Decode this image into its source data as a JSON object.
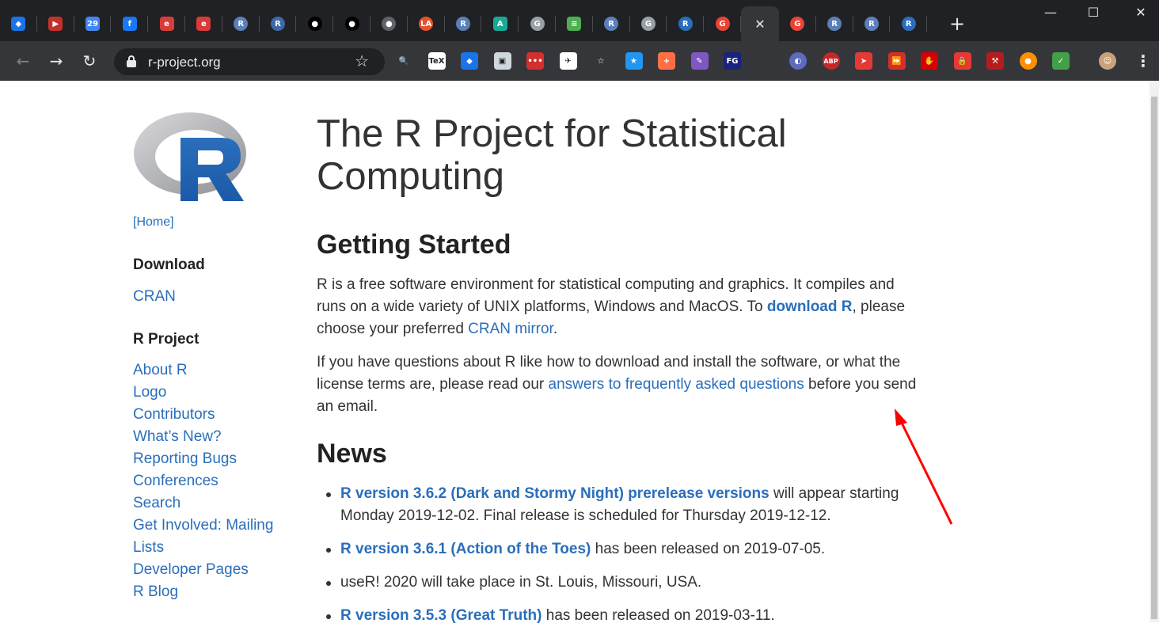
{
  "tabs": [
    {
      "icon": "gem-icon",
      "color": "#1a73e8",
      "glyph": "◆"
    },
    {
      "icon": "youtube-icon",
      "color": "#c4302b",
      "glyph": "▶"
    },
    {
      "icon": "calendar-icon",
      "color": "#4285f4",
      "glyph": "29"
    },
    {
      "icon": "facebook-icon",
      "color": "#1877f2",
      "glyph": "f"
    },
    {
      "icon": "red-circle-icon",
      "color": "#d93a3a",
      "glyph": "e"
    },
    {
      "icon": "red-circle-icon",
      "color": "#d93a3a",
      "glyph": "e"
    },
    {
      "icon": "r-logo-icon",
      "color": "#5b7fb8",
      "glyph": "R"
    },
    {
      "icon": "r-logo-icon",
      "color": "#3c6aa8",
      "glyph": "R"
    },
    {
      "icon": "github-icon",
      "color": "#000000",
      "glyph": "●"
    },
    {
      "icon": "github-icon",
      "color": "#000000",
      "glyph": "●"
    },
    {
      "icon": "globe-icon",
      "color": "#5f6368",
      "glyph": "●"
    },
    {
      "icon": "la-icon",
      "color": "#e5532d",
      "glyph": "LA"
    },
    {
      "icon": "r-logo-icon",
      "color": "#5b7fb8",
      "glyph": "R"
    },
    {
      "icon": "a-logo-icon",
      "color": "#18a999",
      "glyph": "A"
    },
    {
      "icon": "google-icon",
      "color": "#9aa0a6",
      "glyph": "G"
    },
    {
      "icon": "document-icon",
      "color": "#4caf50",
      "glyph": "≡"
    },
    {
      "icon": "r-logo-icon",
      "color": "#5b7fb8",
      "glyph": "R"
    },
    {
      "icon": "google-icon",
      "color": "#9aa0a6",
      "glyph": "G"
    },
    {
      "icon": "r-logo-icon",
      "color": "#2a6ebb",
      "glyph": "R"
    },
    {
      "icon": "google-icon",
      "color": "#ea4335",
      "glyph": "G"
    }
  ],
  "tabs_after": [
    {
      "icon": "google-icon",
      "color": "#ea4335",
      "glyph": "G"
    },
    {
      "icon": "r-logo-icon",
      "color": "#5b7fb8",
      "glyph": "R"
    },
    {
      "icon": "r-logo-icon",
      "color": "#5b7fb8",
      "glyph": "R"
    },
    {
      "icon": "r-logo-icon",
      "color": "#2a6ebb",
      "glyph": "R"
    }
  ],
  "toolbar": {
    "url": "r-project.org"
  },
  "extensions": [
    {
      "icon": "magnifier-icon",
      "color": "#35363a",
      "glyph": "🔍"
    },
    {
      "icon": "tex-icon",
      "color": "#ffffff",
      "glyph": "TeX"
    },
    {
      "icon": "gem-icon",
      "color": "#1a73e8",
      "glyph": "◆"
    },
    {
      "icon": "image-icon",
      "color": "#cfd8dc",
      "glyph": "▣"
    },
    {
      "icon": "dots-icon",
      "color": "#d32f2f",
      "glyph": "•••"
    },
    {
      "icon": "rocket-icon",
      "color": "#ffffff",
      "glyph": "✈"
    },
    {
      "icon": "star-outline-icon",
      "color": "#35363a",
      "glyph": "☆"
    },
    {
      "icon": "star-badge-icon",
      "color": "#2196f3",
      "glyph": "★"
    },
    {
      "icon": "plus-icon",
      "color": "#ff6f43",
      "glyph": "+"
    },
    {
      "icon": "feather-icon",
      "color": "#7e57c2",
      "glyph": "✎"
    },
    {
      "icon": "fg-icon",
      "color": "#1a237e",
      "glyph": "FG"
    },
    {
      "icon": "blank-icon",
      "color": "#35363a",
      "glyph": ""
    },
    {
      "icon": "moon-icon",
      "color": "#5c6bc0",
      "glyph": "◐"
    },
    {
      "icon": "abp-icon",
      "color": "#c62828",
      "glyph": "ABP"
    },
    {
      "icon": "rocket-red-icon",
      "color": "#e53935",
      "glyph": "➤"
    },
    {
      "icon": "fast-forward-icon",
      "color": "#d32f2f",
      "glyph": "⏩"
    },
    {
      "icon": "hand-stop-icon",
      "color": "#d50000",
      "glyph": "✋"
    },
    {
      "icon": "shield-lock-icon",
      "color": "#e53935",
      "glyph": "🔒"
    },
    {
      "icon": "tools-icon",
      "color": "#b71c1c",
      "glyph": "⚒"
    },
    {
      "icon": "circle-orange-icon",
      "color": "#ff8f00",
      "glyph": "●"
    },
    {
      "icon": "shield-check-icon",
      "color": "#43a047",
      "glyph": "✓"
    }
  ],
  "sidebar": {
    "home": "[Home]",
    "download_heading": "Download",
    "cran": "CRAN",
    "project_heading": "R Project",
    "links": [
      "About R",
      "Logo",
      "Contributors",
      "What’s New?",
      "Reporting Bugs",
      "Conferences",
      "Search",
      "Get Involved: Mailing",
      "Lists",
      "Developer Pages",
      "R Blog"
    ]
  },
  "main": {
    "title": "The R Project for Statistical Computing",
    "getting_started": "Getting Started",
    "p1_a": "R is a free software environment for statistical computing and graphics. It compiles and runs on a wide variety of UNIX platforms, Windows and MacOS. To ",
    "p1_link1": "download R",
    "p1_b": ", please choose your preferred ",
    "p1_link2": "CRAN mirror",
    "p1_c": ".",
    "p2_a": "If you have questions about R like how to download and install the software, or what the license terms are, please read our ",
    "p2_link": "answers to frequently asked questions",
    "p2_b": " before you send an email.",
    "news_heading": "News",
    "news": [
      {
        "link": "R version 3.6.2 (Dark and Stormy Night) prerelease versions",
        "text": " will appear starting Monday 2019-12-02. Final release is scheduled for Thursday 2019-12-12."
      },
      {
        "link": "R version 3.6.1 (Action of the Toes)",
        "text": " has been released on 2019-07-05."
      },
      {
        "link": "",
        "text": "useR! 2020 will take place in St. Louis, Missouri, USA."
      },
      {
        "link": "R version 3.5.3 (Great Truth)",
        "text": " has been released on 2019-03-11."
      }
    ]
  }
}
